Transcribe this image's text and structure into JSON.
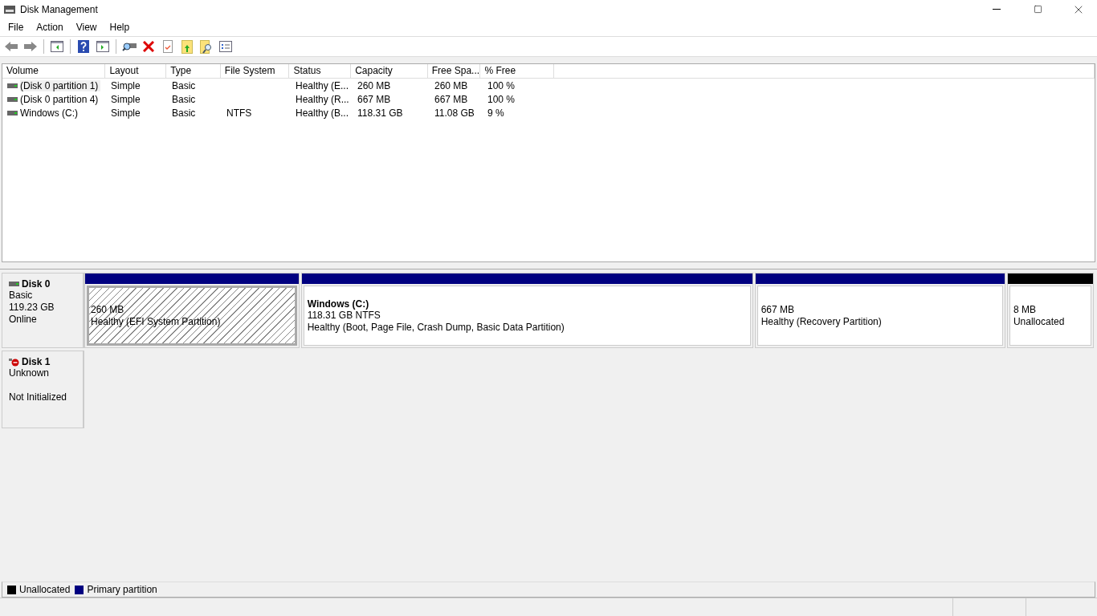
{
  "window": {
    "title": "Disk Management"
  },
  "menu": [
    "File",
    "Action",
    "View",
    "Help"
  ],
  "table": {
    "columns": [
      "Volume",
      "Layout",
      "Type",
      "File System",
      "Status",
      "Capacity",
      "Free Spa...",
      "% Free"
    ],
    "rows": [
      {
        "selected": true,
        "cells": [
          "(Disk 0 partition 1)",
          "Simple",
          "Basic",
          "",
          "Healthy (E...",
          "260 MB",
          "260 MB",
          "100 %"
        ]
      },
      {
        "selected": false,
        "cells": [
          "(Disk 0 partition 4)",
          "Simple",
          "Basic",
          "",
          "Healthy (R...",
          "667 MB",
          "667 MB",
          "100 %"
        ]
      },
      {
        "selected": false,
        "cells": [
          "Windows (C:)",
          "Simple",
          "Basic",
          "NTFS",
          "Healthy (B...",
          "118.31 GB",
          "11.08 GB",
          "9 %"
        ]
      }
    ]
  },
  "disks": [
    {
      "name": "Disk 0",
      "error": false,
      "lines": [
        "Basic",
        "119.23 GB"
      ],
      "status": "Online",
      "partitions": [
        {
          "selected": true,
          "color": "#000080",
          "lines": [
            "260 MB",
            "Healthy (EFI System Partition)"
          ]
        },
        {
          "selected": false,
          "color": "#000080",
          "title": "Windows  (C:)",
          "lines": [
            "118.31 GB NTFS",
            "Healthy (Boot, Page File, Crash Dump, Basic Data Partition)"
          ]
        },
        {
          "selected": false,
          "color": "#000080",
          "lines": [
            "667 MB",
            "Healthy (Recovery Partition)"
          ]
        },
        {
          "selected": false,
          "color": "#000000",
          "lines": [
            "8 MB",
            "Unallocated"
          ]
        }
      ]
    },
    {
      "name": "Disk 1",
      "error": true,
      "lines": [
        "Unknown"
      ],
      "status": "Not Initialized"
    }
  ],
  "legend": [
    {
      "label": "Unallocated",
      "color": "#000000"
    },
    {
      "label": "Primary partition",
      "color": "#000080"
    }
  ]
}
